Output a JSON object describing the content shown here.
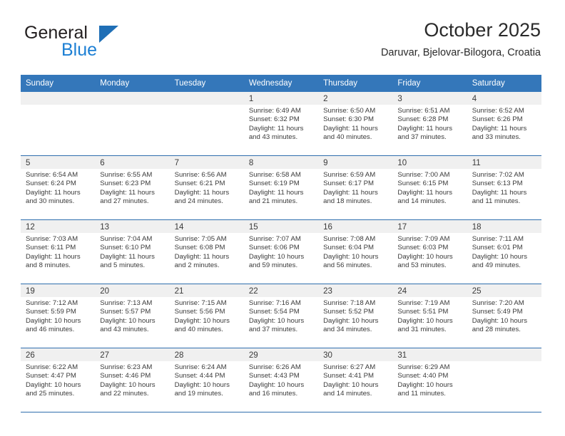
{
  "brand": {
    "name_part1": "General",
    "name_part2": "Blue",
    "logo_icon": "triangle-logo-icon",
    "accent_color": "#1f6fb6"
  },
  "header": {
    "title": "October 2025",
    "subtitle": "Daruvar, Bjelovar-Bilogora, Croatia"
  },
  "theme": {
    "header_row_color": "#3477ba",
    "day_band_color": "#f0f0f0",
    "grid_line_color": "#2f6eae"
  },
  "calendar": {
    "weekdays": [
      "Sunday",
      "Monday",
      "Tuesday",
      "Wednesday",
      "Thursday",
      "Friday",
      "Saturday"
    ],
    "weeks": [
      [
        {
          "day": "",
          "sunrise": "",
          "sunset": "",
          "daylight_line1": "",
          "daylight_line2": "",
          "empty": true
        },
        {
          "day": "",
          "sunrise": "",
          "sunset": "",
          "daylight_line1": "",
          "daylight_line2": "",
          "empty": true
        },
        {
          "day": "",
          "sunrise": "",
          "sunset": "",
          "daylight_line1": "",
          "daylight_line2": "",
          "empty": true
        },
        {
          "day": "1",
          "sunrise": "Sunrise: 6:49 AM",
          "sunset": "Sunset: 6:32 PM",
          "daylight_line1": "Daylight: 11 hours",
          "daylight_line2": "and 43 minutes."
        },
        {
          "day": "2",
          "sunrise": "Sunrise: 6:50 AM",
          "sunset": "Sunset: 6:30 PM",
          "daylight_line1": "Daylight: 11 hours",
          "daylight_line2": "and 40 minutes."
        },
        {
          "day": "3",
          "sunrise": "Sunrise: 6:51 AM",
          "sunset": "Sunset: 6:28 PM",
          "daylight_line1": "Daylight: 11 hours",
          "daylight_line2": "and 37 minutes."
        },
        {
          "day": "4",
          "sunrise": "Sunrise: 6:52 AM",
          "sunset": "Sunset: 6:26 PM",
          "daylight_line1": "Daylight: 11 hours",
          "daylight_line2": "and 33 minutes."
        }
      ],
      [
        {
          "day": "5",
          "sunrise": "Sunrise: 6:54 AM",
          "sunset": "Sunset: 6:24 PM",
          "daylight_line1": "Daylight: 11 hours",
          "daylight_line2": "and 30 minutes."
        },
        {
          "day": "6",
          "sunrise": "Sunrise: 6:55 AM",
          "sunset": "Sunset: 6:23 PM",
          "daylight_line1": "Daylight: 11 hours",
          "daylight_line2": "and 27 minutes."
        },
        {
          "day": "7",
          "sunrise": "Sunrise: 6:56 AM",
          "sunset": "Sunset: 6:21 PM",
          "daylight_line1": "Daylight: 11 hours",
          "daylight_line2": "and 24 minutes."
        },
        {
          "day": "8",
          "sunrise": "Sunrise: 6:58 AM",
          "sunset": "Sunset: 6:19 PM",
          "daylight_line1": "Daylight: 11 hours",
          "daylight_line2": "and 21 minutes."
        },
        {
          "day": "9",
          "sunrise": "Sunrise: 6:59 AM",
          "sunset": "Sunset: 6:17 PM",
          "daylight_line1": "Daylight: 11 hours",
          "daylight_line2": "and 18 minutes."
        },
        {
          "day": "10",
          "sunrise": "Sunrise: 7:00 AM",
          "sunset": "Sunset: 6:15 PM",
          "daylight_line1": "Daylight: 11 hours",
          "daylight_line2": "and 14 minutes."
        },
        {
          "day": "11",
          "sunrise": "Sunrise: 7:02 AM",
          "sunset": "Sunset: 6:13 PM",
          "daylight_line1": "Daylight: 11 hours",
          "daylight_line2": "and 11 minutes."
        }
      ],
      [
        {
          "day": "12",
          "sunrise": "Sunrise: 7:03 AM",
          "sunset": "Sunset: 6:11 PM",
          "daylight_line1": "Daylight: 11 hours",
          "daylight_line2": "and 8 minutes."
        },
        {
          "day": "13",
          "sunrise": "Sunrise: 7:04 AM",
          "sunset": "Sunset: 6:10 PM",
          "daylight_line1": "Daylight: 11 hours",
          "daylight_line2": "and 5 minutes."
        },
        {
          "day": "14",
          "sunrise": "Sunrise: 7:05 AM",
          "sunset": "Sunset: 6:08 PM",
          "daylight_line1": "Daylight: 11 hours",
          "daylight_line2": "and 2 minutes."
        },
        {
          "day": "15",
          "sunrise": "Sunrise: 7:07 AM",
          "sunset": "Sunset: 6:06 PM",
          "daylight_line1": "Daylight: 10 hours",
          "daylight_line2": "and 59 minutes."
        },
        {
          "day": "16",
          "sunrise": "Sunrise: 7:08 AM",
          "sunset": "Sunset: 6:04 PM",
          "daylight_line1": "Daylight: 10 hours",
          "daylight_line2": "and 56 minutes."
        },
        {
          "day": "17",
          "sunrise": "Sunrise: 7:09 AM",
          "sunset": "Sunset: 6:03 PM",
          "daylight_line1": "Daylight: 10 hours",
          "daylight_line2": "and 53 minutes."
        },
        {
          "day": "18",
          "sunrise": "Sunrise: 7:11 AM",
          "sunset": "Sunset: 6:01 PM",
          "daylight_line1": "Daylight: 10 hours",
          "daylight_line2": "and 49 minutes."
        }
      ],
      [
        {
          "day": "19",
          "sunrise": "Sunrise: 7:12 AM",
          "sunset": "Sunset: 5:59 PM",
          "daylight_line1": "Daylight: 10 hours",
          "daylight_line2": "and 46 minutes."
        },
        {
          "day": "20",
          "sunrise": "Sunrise: 7:13 AM",
          "sunset": "Sunset: 5:57 PM",
          "daylight_line1": "Daylight: 10 hours",
          "daylight_line2": "and 43 minutes."
        },
        {
          "day": "21",
          "sunrise": "Sunrise: 7:15 AM",
          "sunset": "Sunset: 5:56 PM",
          "daylight_line1": "Daylight: 10 hours",
          "daylight_line2": "and 40 minutes."
        },
        {
          "day": "22",
          "sunrise": "Sunrise: 7:16 AM",
          "sunset": "Sunset: 5:54 PM",
          "daylight_line1": "Daylight: 10 hours",
          "daylight_line2": "and 37 minutes."
        },
        {
          "day": "23",
          "sunrise": "Sunrise: 7:18 AM",
          "sunset": "Sunset: 5:52 PM",
          "daylight_line1": "Daylight: 10 hours",
          "daylight_line2": "and 34 minutes."
        },
        {
          "day": "24",
          "sunrise": "Sunrise: 7:19 AM",
          "sunset": "Sunset: 5:51 PM",
          "daylight_line1": "Daylight: 10 hours",
          "daylight_line2": "and 31 minutes."
        },
        {
          "day": "25",
          "sunrise": "Sunrise: 7:20 AM",
          "sunset": "Sunset: 5:49 PM",
          "daylight_line1": "Daylight: 10 hours",
          "daylight_line2": "and 28 minutes."
        }
      ],
      [
        {
          "day": "26",
          "sunrise": "Sunrise: 6:22 AM",
          "sunset": "Sunset: 4:47 PM",
          "daylight_line1": "Daylight: 10 hours",
          "daylight_line2": "and 25 minutes."
        },
        {
          "day": "27",
          "sunrise": "Sunrise: 6:23 AM",
          "sunset": "Sunset: 4:46 PM",
          "daylight_line1": "Daylight: 10 hours",
          "daylight_line2": "and 22 minutes."
        },
        {
          "day": "28",
          "sunrise": "Sunrise: 6:24 AM",
          "sunset": "Sunset: 4:44 PM",
          "daylight_line1": "Daylight: 10 hours",
          "daylight_line2": "and 19 minutes."
        },
        {
          "day": "29",
          "sunrise": "Sunrise: 6:26 AM",
          "sunset": "Sunset: 4:43 PM",
          "daylight_line1": "Daylight: 10 hours",
          "daylight_line2": "and 16 minutes."
        },
        {
          "day": "30",
          "sunrise": "Sunrise: 6:27 AM",
          "sunset": "Sunset: 4:41 PM",
          "daylight_line1": "Daylight: 10 hours",
          "daylight_line2": "and 14 minutes."
        },
        {
          "day": "31",
          "sunrise": "Sunrise: 6:29 AM",
          "sunset": "Sunset: 4:40 PM",
          "daylight_line1": "Daylight: 10 hours",
          "daylight_line2": "and 11 minutes."
        },
        {
          "day": "",
          "sunrise": "",
          "sunset": "",
          "daylight_line1": "",
          "daylight_line2": "",
          "empty": true
        }
      ]
    ]
  }
}
